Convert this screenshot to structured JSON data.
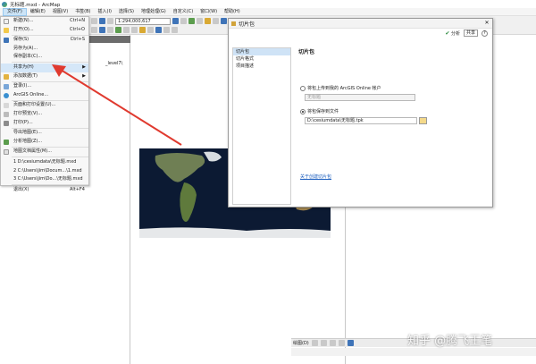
{
  "window": {
    "title": "无标题.mxd - ArcMap"
  },
  "menubar": [
    "文件(F)",
    "编辑(E)",
    "视图(V)",
    "书签(B)",
    "插入(I)",
    "选择(S)",
    "地理处理(G)",
    "自定义(C)",
    "窗口(W)",
    "帮助(H)"
  ],
  "toolbar": {
    "scale": "1:294,000,617"
  },
  "toc": {
    "layer_text": "_level7\\"
  },
  "file_menu": [
    {
      "label": "新建(N)...",
      "shortcut": "Ctrl+N"
    },
    {
      "label": "打开(O)...",
      "shortcut": "Ctrl+O"
    },
    {
      "label": "保存(S)",
      "shortcut": "Ctrl+S"
    },
    {
      "label": "另存为(A)..."
    },
    {
      "label": "保存副本(C)..."
    },
    {
      "label": "共享为(H)",
      "submenu": true
    },
    {
      "label": "添加数据(T)",
      "submenu": true
    },
    {
      "label": "登录(I)..."
    },
    {
      "label": "ArcGIS Online..."
    },
    {
      "label": "页面和打印设置(U)..."
    },
    {
      "label": "打印预览(V)..."
    },
    {
      "label": "打印(P)..."
    },
    {
      "label": "导出地图(E)..."
    },
    {
      "label": "分析地图(Z)..."
    },
    {
      "label": "地图文档属性(M)..."
    },
    {
      "label": "1 D:\\cesiumdata\\无标题.mxd"
    },
    {
      "label": "2 C:\\Users\\jim\\Docum...\\1.mxd"
    },
    {
      "label": "3 C:\\Users\\jim\\Do...\\无标题.mxd"
    },
    {
      "label": "退出(X)",
      "shortcut": "Alt+F4"
    }
  ],
  "dialog": {
    "title": "切片包",
    "toolbar": {
      "analyze": "分析",
      "share": "共享"
    },
    "nav": [
      "切片包",
      "切片格式",
      "项目描述"
    ],
    "heading": "切片包",
    "option_upload": "将包上传到我的 ArcGIS Online 帐户",
    "upload_field_placeholder": "无标题",
    "option_save": "将包保存到文件",
    "save_path": "D:\\cesiumdata\\无标题.tpk",
    "link": "关于创建切片包"
  },
  "bottombar": {
    "label": "绘图(D)"
  },
  "watermark": "知乎 @腾飞王笔",
  "colors": {
    "menu_highlight": "#d5e7f8",
    "arrow": "#e03a2f",
    "link": "#1d5fbf"
  }
}
